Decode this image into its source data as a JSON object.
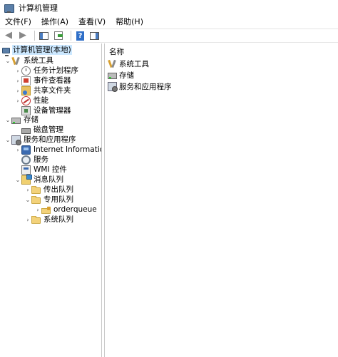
{
  "window": {
    "title": "计算机管理"
  },
  "menu": [
    "文件(F)",
    "操作(A)",
    "查看(V)",
    "帮助(H)"
  ],
  "tree": {
    "root": "计算机管理(本地)",
    "system_tools": "系统工具",
    "task_scheduler": "任务计划程序",
    "event_viewer": "事件查看器",
    "shared_folders": "共享文件夹",
    "performance": "性能",
    "device_manager": "设备管理器",
    "storage": "存储",
    "disk_management": "磁盘管理",
    "services_apps": "服务和应用程序",
    "iis": "Internet Information Se",
    "services": "服务",
    "wmi": "WMI 控件",
    "msmq": "消息队列",
    "outgoing": "传出队列",
    "private": "专用队列",
    "orderqueue": "orderqueue",
    "system_queues": "系统队列"
  },
  "list": {
    "header": "名称",
    "items": [
      "系统工具",
      "存储",
      "服务和应用程序"
    ]
  }
}
